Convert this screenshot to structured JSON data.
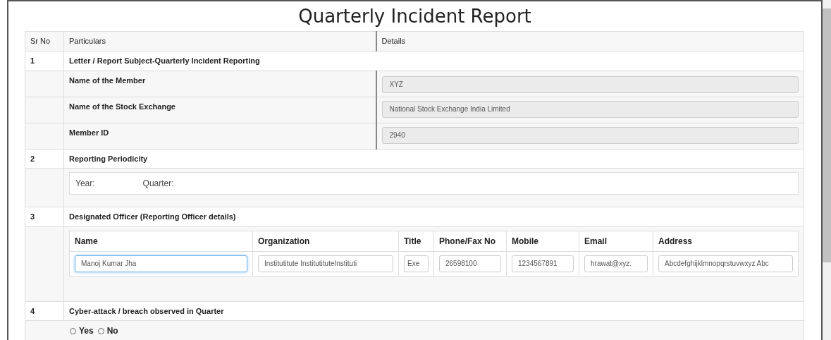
{
  "title": "Quarterly Incident Report",
  "columns": [
    "Sr No",
    "Particulars",
    "Details"
  ],
  "sections": [
    {
      "sr": "1",
      "heading": "Letter / Report Subject-Quarterly Incident Reporting",
      "kind": "fields",
      "fields": [
        {
          "label": "Name of the Member",
          "value": "XYZ"
        },
        {
          "label": "Name of the Stock Exchange",
          "value": "National Stock Exchange India Limited"
        },
        {
          "label": "Member ID",
          "value": "2940"
        }
      ]
    },
    {
      "sr": "2",
      "heading": "Reporting Periodicity",
      "kind": "period",
      "labels": [
        "Year:",
        "Quarter:"
      ]
    },
    {
      "sr": "3",
      "heading": "Designated Officer (Reporting Officer details)",
      "kind": "officer",
      "columns": [
        "Name",
        "Organization",
        "Title",
        "Phone/Fax No",
        "Mobile",
        "Email",
        "Address"
      ],
      "values": [
        {
          "value": "Manoj Kumar Jha",
          "focused": true
        },
        {
          "value": "Institutitute InstitutituteInstituti",
          "focused": false
        },
        {
          "value": "Exe",
          "focused": false
        },
        {
          "value": "26598100",
          "focused": false
        },
        {
          "value": "1234567891",
          "focused": false
        },
        {
          "value": "hrawat@xyz.",
          "focused": false
        },
        {
          "value": "Abcdefghijklmnopqrstuvwxyz Abc",
          "focused": false
        }
      ]
    },
    {
      "sr": "4",
      "heading": "Cyber-attack / breach observed in Quarter",
      "kind": "radios",
      "options": [
        {
          "label": "Yes",
          "selected": false
        },
        {
          "label": "No",
          "selected": false
        }
      ]
    }
  ]
}
